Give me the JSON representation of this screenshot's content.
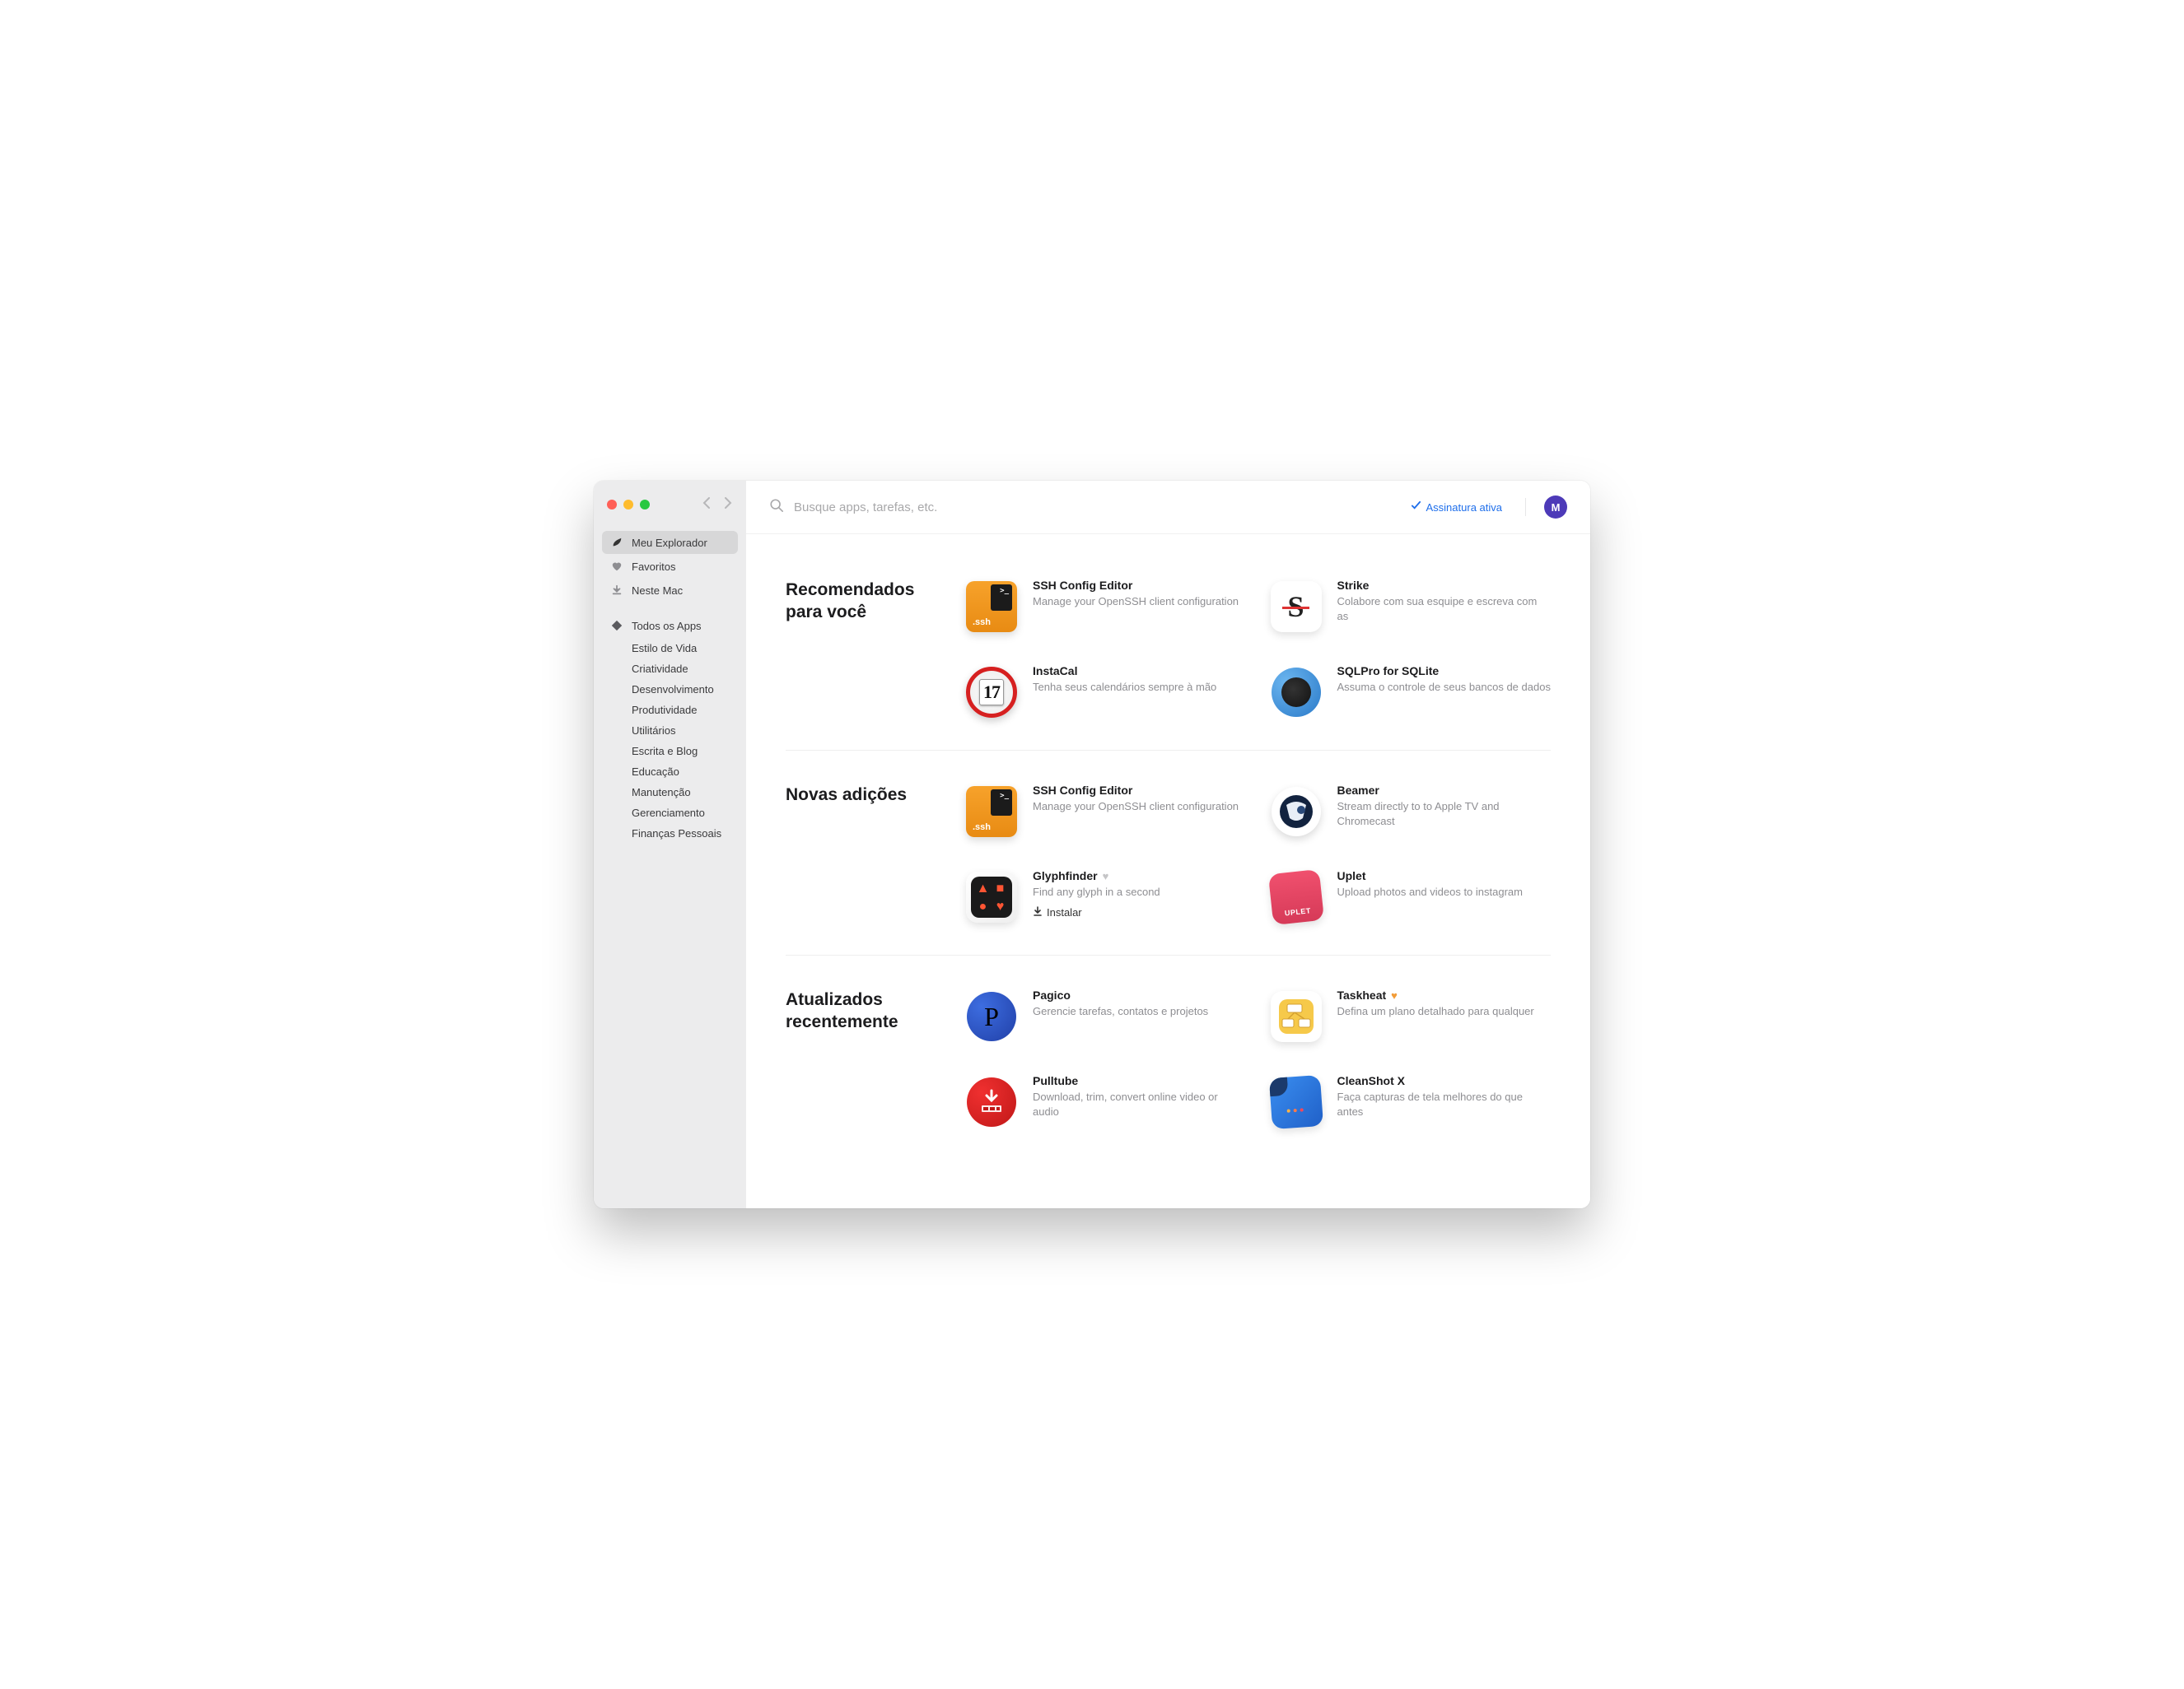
{
  "sidebar": {
    "nav": [
      {
        "id": "explorer",
        "label": "Meu Explorador",
        "icon": "leaf",
        "active": true
      },
      {
        "id": "favorites",
        "label": "Favoritos",
        "icon": "heart"
      },
      {
        "id": "thismac",
        "label": "Neste Mac",
        "icon": "download"
      },
      {
        "id": "allapps",
        "label": "Todos os Apps",
        "icon": "diamond"
      }
    ],
    "categories": [
      "Estilo de Vida",
      "Criatividade",
      "Desenvolvimento",
      "Produtividade",
      "Utilitários",
      "Escrita e Blog",
      "Educação",
      "Manutenção",
      "Gerenciamento",
      "Finanças Pessoais"
    ]
  },
  "header": {
    "search_placeholder": "Busque apps, tarefas, etc.",
    "subscription_label": "Assinatura ativa",
    "avatar_initial": "M"
  },
  "sections": [
    {
      "id": "recommended",
      "title": "Recomendados para você",
      "apps": [
        {
          "id": "sshconfig1",
          "name": "SSH Config Editor",
          "desc": "Manage your OpenSSH client configuration",
          "icon": "ssh"
        },
        {
          "id": "strike",
          "name": "Strike",
          "desc": "Colabore com sua esquipe e escreva com as",
          "icon": "strike"
        },
        {
          "id": "instacal",
          "name": "InstaCal",
          "desc": "Tenha seus calendários sempre à mão",
          "icon": "instacal",
          "iconNum": "17"
        },
        {
          "id": "sqlpro",
          "name": "SQLPro for SQLite",
          "desc": "Assuma o controle de seus bancos de dados",
          "icon": "sqlpro"
        }
      ]
    },
    {
      "id": "new",
      "title": "Novas adições",
      "apps": [
        {
          "id": "sshconfig2",
          "name": "SSH Config Editor",
          "desc": "Manage your OpenSSH client configuration",
          "icon": "ssh"
        },
        {
          "id": "beamer",
          "name": "Beamer",
          "desc": "Stream directly to to Apple TV and Chromecast",
          "icon": "beamer"
        },
        {
          "id": "glyphfinder",
          "name": "Glyphfinder",
          "desc": "Find any glyph in a second",
          "icon": "glyph",
          "heart": true,
          "install": "Instalar"
        },
        {
          "id": "uplet",
          "name": "Uplet",
          "desc": "Upload photos and videos to instagram",
          "icon": "uplet"
        }
      ]
    },
    {
      "id": "updated",
      "title": "Atualizados recentemente",
      "apps": [
        {
          "id": "pagico",
          "name": "Pagico",
          "desc": "Gerencie tarefas, contatos e projetos",
          "icon": "pagico"
        },
        {
          "id": "taskheat",
          "name": "Taskheat",
          "desc": "Defina um plano detalhado para qualquer",
          "icon": "taskheat",
          "heart": true,
          "heartFav": true
        },
        {
          "id": "pulltube",
          "name": "Pulltube",
          "desc": "Download, trim, convert online video or audio",
          "icon": "pulltube"
        },
        {
          "id": "cleanshot",
          "name": "CleanShot X",
          "desc": "Faça capturas de tela melhores do que antes",
          "icon": "cleanshot"
        }
      ]
    }
  ]
}
